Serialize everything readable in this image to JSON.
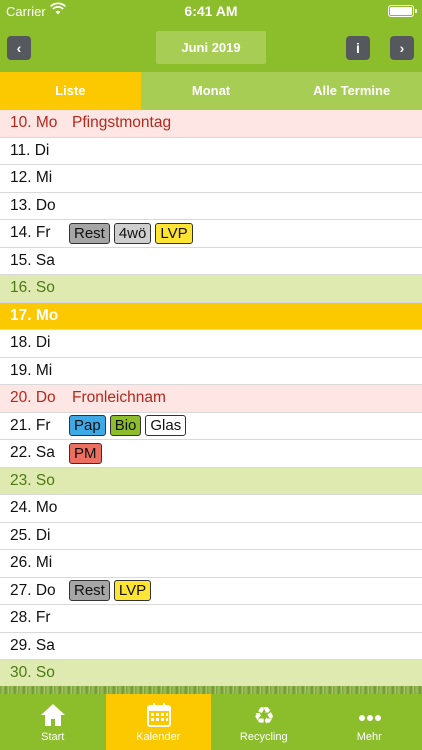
{
  "status": {
    "carrier": "Carrier",
    "time": "6:41 AM"
  },
  "header": {
    "month_title": "Juni 2019"
  },
  "segments": [
    "Liste",
    "Monat",
    "Alle Termine"
  ],
  "colors": {
    "green": "#8cbd2a",
    "light_green": "#a7cd54",
    "yellow": "#fcc900",
    "holiday_bg": "#fde6e3",
    "sunday_bg": "#dfeab1"
  },
  "tag_colors": {
    "Rest": "#a6a6a6",
    "4wö": "#cfcfcf",
    "LVP": "#ffe433",
    "Pap": "#3fa9e6",
    "Bio": "#8cbd2a",
    "Glas": "#ffffff",
    "PM": "#ec6f62"
  },
  "rows": [
    {
      "date": "10. Mo",
      "type": "holiday",
      "holiday": "Pfingstmontag",
      "tags": []
    },
    {
      "date": "11. Di",
      "type": "normal",
      "holiday": "",
      "tags": []
    },
    {
      "date": "12. Mi",
      "type": "normal",
      "holiday": "",
      "tags": []
    },
    {
      "date": "13. Do",
      "type": "normal",
      "holiday": "",
      "tags": []
    },
    {
      "date": "14. Fr",
      "type": "normal",
      "holiday": "",
      "tags": [
        "Rest",
        "4wö",
        "LVP"
      ]
    },
    {
      "date": "15. Sa",
      "type": "normal",
      "holiday": "",
      "tags": []
    },
    {
      "date": "16. So",
      "type": "sunday",
      "holiday": "",
      "tags": []
    },
    {
      "date": "17. Mo",
      "type": "today",
      "holiday": "",
      "tags": []
    },
    {
      "date": "18. Di",
      "type": "normal",
      "holiday": "",
      "tags": []
    },
    {
      "date": "19. Mi",
      "type": "normal",
      "holiday": "",
      "tags": []
    },
    {
      "date": "20. Do",
      "type": "holiday",
      "holiday": "Fronleichnam",
      "tags": []
    },
    {
      "date": "21. Fr",
      "type": "normal",
      "holiday": "",
      "tags": [
        "Pap",
        "Bio",
        "Glas"
      ]
    },
    {
      "date": "22. Sa",
      "type": "normal",
      "holiday": "",
      "tags": [
        "PM"
      ]
    },
    {
      "date": "23. So",
      "type": "sunday",
      "holiday": "",
      "tags": []
    },
    {
      "date": "24. Mo",
      "type": "normal",
      "holiday": "",
      "tags": []
    },
    {
      "date": "25. Di",
      "type": "normal",
      "holiday": "",
      "tags": []
    },
    {
      "date": "26. Mi",
      "type": "normal",
      "holiday": "",
      "tags": []
    },
    {
      "date": "27. Do",
      "type": "normal",
      "holiday": "",
      "tags": [
        "Rest",
        "LVP"
      ]
    },
    {
      "date": "28. Fr",
      "type": "normal",
      "holiday": "",
      "tags": []
    },
    {
      "date": "29. Sa",
      "type": "normal",
      "holiday": "",
      "tags": []
    },
    {
      "date": "30. So",
      "type": "sunday",
      "holiday": "",
      "tags": []
    }
  ],
  "tabbar": [
    {
      "label": "Start",
      "icon": "home-icon",
      "active": false
    },
    {
      "label": "Kalender",
      "icon": "calendar-icon",
      "active": true
    },
    {
      "label": "Recycling",
      "icon": "recycle-icon",
      "active": false
    },
    {
      "label": "Mehr",
      "icon": "more-icon",
      "active": false
    }
  ]
}
